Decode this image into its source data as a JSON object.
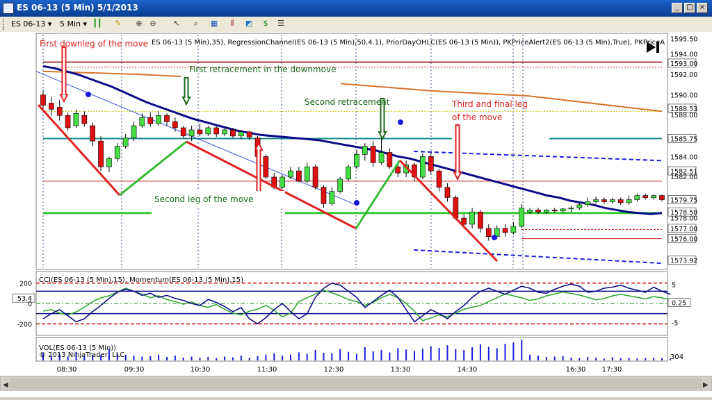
{
  "window": {
    "title": "ES 06-13 (5 Min)  5/1/2013",
    "minimize": "_",
    "maximize": "□",
    "close": "×"
  },
  "toolbar": {
    "instrument": "ES 06-13",
    "period": "5 Min"
  },
  "colors": {
    "up_candle": "#44dd44",
    "down_candle": "#e01010",
    "regression": "#0b0b8a",
    "annotation_red": "#e02020",
    "annotation_green": "#1a6a1a",
    "cci": "#0b0b8a",
    "momentum": "#33aa33"
  },
  "price_panel": {
    "legend": "ES 06-13 (5 Min),35), RegressionChannel(ES 06-13 (5 Min),50,4.1), PriorDayOHLC(ES 06-13 (5 Min)), PKPriceAlert2(ES 06-13 (5 Min),True), PKPriceA",
    "axis_labels": [
      "1595.50",
      "1594.00",
      "1593.00",
      "1592.00",
      "1590.00",
      "1588.53",
      "1588.00",
      "1585.75",
      "1584.00",
      "1582.51",
      "1582.00",
      "1579.75",
      "1578.50",
      "1578.00",
      "1577.00",
      "1576.00",
      "1573.92"
    ],
    "annotations": {
      "first_downleg": "First downleg of the move",
      "first_retracement": "First retracement in the downmove",
      "second_retracement": "Second retracement",
      "third_leg_line1": "Third and final leg",
      "third_leg_line2": "of the move",
      "second_leg": "Second leg of the move"
    }
  },
  "indicator_panel": {
    "legend": "CCI(ES 06-13 (5 Min),15), Momentum(ES 06-13 (5 Min),15)",
    "left_labels": [
      "200",
      "53.4",
      "0",
      "-200"
    ],
    "right_labels": [
      "5",
      "0.25",
      "-5"
    ]
  },
  "volume_panel": {
    "legend": "VOL(ES 06-13 (5 Min))",
    "copyright": "© 2013 NinjaTrader, LLC",
    "right_label": "304"
  },
  "time_axis": {
    "labels": [
      "08:30",
      "09:30",
      "10:30",
      "11:30",
      "12:30",
      "13:30",
      "14:30",
      "16:30",
      "17:30"
    ]
  },
  "chart_data": {
    "type": "candlestick",
    "x_labels": [
      "08:30",
      "09:30",
      "10:30",
      "11:30",
      "12:30",
      "13:30",
      "14:30",
      "16:30",
      "17:30"
    ],
    "price_range": [
      1573.0,
      1596.0
    ],
    "candles": [
      {
        "o": 1590.0,
        "c": 1589.0,
        "h": 1590.5,
        "l": 1588.5
      },
      {
        "o": 1589.2,
        "c": 1588.6,
        "h": 1589.8,
        "l": 1588.0
      },
      {
        "o": 1588.8,
        "c": 1588.0,
        "h": 1589.5,
        "l": 1587.5
      },
      {
        "o": 1588.0,
        "c": 1586.8,
        "h": 1588.3,
        "l": 1586.5
      },
      {
        "o": 1587.0,
        "c": 1588.2,
        "h": 1588.6,
        "l": 1586.8
      },
      {
        "o": 1588.0,
        "c": 1587.2,
        "h": 1588.4,
        "l": 1586.9
      },
      {
        "o": 1587.0,
        "c": 1585.5,
        "h": 1587.3,
        "l": 1585.0
      },
      {
        "o": 1585.5,
        "c": 1583.0,
        "h": 1586.0,
        "l": 1582.6
      },
      {
        "o": 1583.0,
        "c": 1583.8,
        "h": 1584.0,
        "l": 1582.5
      },
      {
        "o": 1583.8,
        "c": 1585.0,
        "h": 1585.3,
        "l": 1583.5
      },
      {
        "o": 1585.0,
        "c": 1585.8,
        "h": 1586.2,
        "l": 1584.8
      },
      {
        "o": 1585.8,
        "c": 1587.0,
        "h": 1587.4,
        "l": 1585.5
      },
      {
        "o": 1587.0,
        "c": 1587.8,
        "h": 1588.2,
        "l": 1586.8
      },
      {
        "o": 1587.8,
        "c": 1587.2,
        "h": 1588.3,
        "l": 1586.9
      },
      {
        "o": 1587.2,
        "c": 1588.0,
        "h": 1588.4,
        "l": 1587.0
      },
      {
        "o": 1588.0,
        "c": 1587.4,
        "h": 1588.2,
        "l": 1587.0
      },
      {
        "o": 1587.4,
        "c": 1586.8,
        "h": 1587.8,
        "l": 1586.4
      },
      {
        "o": 1586.8,
        "c": 1586.0,
        "h": 1587.0,
        "l": 1585.8
      },
      {
        "o": 1586.0,
        "c": 1586.6,
        "h": 1587.0,
        "l": 1585.5
      },
      {
        "o": 1586.6,
        "c": 1586.2,
        "h": 1587.2,
        "l": 1586.0
      },
      {
        "o": 1586.2,
        "c": 1586.8,
        "h": 1587.0,
        "l": 1586.0
      },
      {
        "o": 1586.8,
        "c": 1586.2,
        "h": 1587.0,
        "l": 1585.9
      },
      {
        "o": 1586.2,
        "c": 1586.6,
        "h": 1586.9,
        "l": 1586.0
      },
      {
        "o": 1586.6,
        "c": 1586.0,
        "h": 1586.8,
        "l": 1585.8
      },
      {
        "o": 1586.0,
        "c": 1586.4,
        "h": 1586.6,
        "l": 1585.7
      },
      {
        "o": 1586.4,
        "c": 1585.9,
        "h": 1586.5,
        "l": 1585.6
      },
      {
        "o": 1585.8,
        "c": 1584.0,
        "h": 1586.0,
        "l": 1583.8
      },
      {
        "o": 1584.0,
        "c": 1582.0,
        "h": 1584.2,
        "l": 1581.8
      },
      {
        "o": 1582.0,
        "c": 1581.0,
        "h": 1582.4,
        "l": 1580.8
      },
      {
        "o": 1581.0,
        "c": 1582.0,
        "h": 1582.2,
        "l": 1580.9
      },
      {
        "o": 1582.0,
        "c": 1582.6,
        "h": 1583.0,
        "l": 1581.8
      },
      {
        "o": 1582.6,
        "c": 1581.6,
        "h": 1583.0,
        "l": 1581.5
      },
      {
        "o": 1581.6,
        "c": 1583.0,
        "h": 1583.4,
        "l": 1581.4
      },
      {
        "o": 1583.0,
        "c": 1581.0,
        "h": 1583.2,
        "l": 1580.8
      },
      {
        "o": 1581.0,
        "c": 1579.4,
        "h": 1581.2,
        "l": 1579.0
      },
      {
        "o": 1579.4,
        "c": 1580.6,
        "h": 1581.0,
        "l": 1579.2
      },
      {
        "o": 1580.6,
        "c": 1581.8,
        "h": 1582.0,
        "l": 1580.4
      },
      {
        "o": 1581.8,
        "c": 1583.0,
        "h": 1583.2,
        "l": 1581.6
      },
      {
        "o": 1583.0,
        "c": 1584.2,
        "h": 1584.6,
        "l": 1582.8
      },
      {
        "o": 1584.2,
        "c": 1585.0,
        "h": 1585.3,
        "l": 1583.6
      },
      {
        "o": 1585.0,
        "c": 1583.4,
        "h": 1585.5,
        "l": 1583.0
      },
      {
        "o": 1583.4,
        "c": 1584.4,
        "h": 1586.2,
        "l": 1583.2
      },
      {
        "o": 1584.4,
        "c": 1583.0,
        "h": 1584.8,
        "l": 1582.8
      },
      {
        "o": 1583.0,
        "c": 1582.4,
        "h": 1583.5,
        "l": 1582.0
      },
      {
        "o": 1582.4,
        "c": 1583.2,
        "h": 1583.6,
        "l": 1582.0
      },
      {
        "o": 1583.2,
        "c": 1582.0,
        "h": 1583.4,
        "l": 1581.6
      },
      {
        "o": 1582.0,
        "c": 1584.0,
        "h": 1584.3,
        "l": 1581.8
      },
      {
        "o": 1584.0,
        "c": 1582.6,
        "h": 1584.4,
        "l": 1582.2
      },
      {
        "o": 1582.6,
        "c": 1581.0,
        "h": 1582.8,
        "l": 1580.6
      },
      {
        "o": 1581.0,
        "c": 1580.0,
        "h": 1581.4,
        "l": 1579.6
      },
      {
        "o": 1580.0,
        "c": 1578.0,
        "h": 1580.2,
        "l": 1577.8
      },
      {
        "o": 1578.0,
        "c": 1577.4,
        "h": 1578.4,
        "l": 1577.0
      },
      {
        "o": 1577.4,
        "c": 1578.6,
        "h": 1579.0,
        "l": 1577.0
      },
      {
        "o": 1578.6,
        "c": 1577.0,
        "h": 1578.8,
        "l": 1576.6
      },
      {
        "o": 1577.0,
        "c": 1576.2,
        "h": 1577.4,
        "l": 1575.8
      },
      {
        "o": 1576.2,
        "c": 1577.0,
        "h": 1577.3,
        "l": 1576.0
      },
      {
        "o": 1577.0,
        "c": 1576.6,
        "h": 1577.4,
        "l": 1576.2
      },
      {
        "o": 1576.6,
        "c": 1577.2,
        "h": 1577.6,
        "l": 1576.4
      },
      {
        "o": 1577.2,
        "c": 1579.0,
        "h": 1579.4,
        "l": 1577.0
      },
      {
        "o": 1578.6,
        "c": 1578.8,
        "h": 1579.0,
        "l": 1578.4
      },
      {
        "o": 1578.8,
        "c": 1578.6,
        "h": 1579.0,
        "l": 1578.4
      },
      {
        "o": 1578.6,
        "c": 1578.8,
        "h": 1578.9,
        "l": 1578.4
      },
      {
        "o": 1578.8,
        "c": 1578.7,
        "h": 1579.0,
        "l": 1578.5
      },
      {
        "o": 1578.7,
        "c": 1578.9,
        "h": 1579.0,
        "l": 1578.5
      },
      {
        "o": 1578.9,
        "c": 1579.0,
        "h": 1579.2,
        "l": 1578.6
      },
      {
        "o": 1579.0,
        "c": 1579.3,
        "h": 1579.5,
        "l": 1578.8
      },
      {
        "o": 1579.3,
        "c": 1579.6,
        "h": 1580.0,
        "l": 1579.1
      },
      {
        "o": 1579.6,
        "c": 1579.8,
        "h": 1580.1,
        "l": 1579.4
      },
      {
        "o": 1579.8,
        "c": 1579.6,
        "h": 1580.0,
        "l": 1579.4
      },
      {
        "o": 1579.6,
        "c": 1579.8,
        "h": 1580.0,
        "l": 1579.4
      },
      {
        "o": 1579.8,
        "c": 1579.5,
        "h": 1580.0,
        "l": 1579.3
      },
      {
        "o": 1579.5,
        "c": 1579.8,
        "h": 1580.2,
        "l": 1579.3
      },
      {
        "o": 1579.8,
        "c": 1580.2,
        "h": 1580.4,
        "l": 1579.6
      },
      {
        "o": 1580.2,
        "c": 1580.0,
        "h": 1580.4,
        "l": 1579.8
      },
      {
        "o": 1580.0,
        "c": 1580.2,
        "h": 1580.3,
        "l": 1579.8
      },
      {
        "o": 1580.2,
        "c": 1579.8,
        "h": 1580.3,
        "l": 1579.6
      }
    ],
    "regression_line": [
      1592.8,
      1592.6,
      1592.3,
      1592.0,
      1591.6,
      1591.2,
      1590.8,
      1590.3,
      1589.8,
      1589.3,
      1588.9,
      1588.5,
      1588.1,
      1587.7,
      1587.4,
      1587.1,
      1586.8,
      1586.5,
      1586.3,
      1586.1,
      1586.0,
      1585.9,
      1585.8,
      1585.7,
      1585.6,
      1585.4,
      1585.2,
      1585.0,
      1584.8,
      1584.6,
      1584.3,
      1584.0,
      1583.8,
      1583.5,
      1583.2,
      1582.9,
      1582.6,
      1582.3,
      1582.0,
      1581.7,
      1581.4,
      1581.1,
      1580.8,
      1580.5,
      1580.2,
      1580.0,
      1579.7,
      1579.5,
      1579.3,
      1579.0,
      1578.8,
      1578.6,
      1578.5,
      1578.4,
      1578.5
    ],
    "cci": [
      -150,
      -100,
      -60,
      -120,
      -180,
      -150,
      -80,
      -20,
      50,
      110,
      140,
      120,
      80,
      100,
      60,
      80,
      50,
      30,
      0,
      -20,
      40,
      10,
      -30,
      -80,
      -40,
      -150,
      -200,
      -140,
      -60,
      0,
      -80,
      -150,
      -100,
      60,
      150,
      200,
      180,
      120,
      60,
      -40,
      20,
      80,
      130,
      60,
      -60,
      -180,
      -120,
      -60,
      -100,
      -150,
      -80,
      -20,
      60,
      120,
      150,
      120,
      90,
      130,
      170,
      150,
      110,
      100,
      140,
      170,
      190,
      170,
      110,
      120,
      150,
      160,
      180,
      150,
      130,
      110,
      160,
      120,
      90
    ],
    "momentum": [
      -2.0,
      -1.6,
      -2.5,
      -3.0,
      -2.2,
      -1.0,
      0.5,
      1.5,
      2.0,
      3.0,
      4.0,
      3.2,
      2.4,
      1.5,
      2.0,
      1.0,
      0.5,
      -0.2,
      0.4,
      -0.5,
      -1.0,
      -0.3,
      -1.5,
      -2.5,
      -3.0,
      -2.0,
      -1.5,
      -0.5,
      -1.8,
      -3.5,
      -2.5,
      0.5,
      1.5,
      2.5,
      3.5,
      2.8,
      2.0,
      1.0,
      0.5,
      -0.5,
      0.3,
      1.5,
      2.4,
      1.5,
      0.0,
      -2.0,
      -4.5,
      -3.8,
      -3.0,
      -3.5,
      -2.5,
      -1.5,
      -1.0,
      -0.5,
      0.5,
      1.5,
      2.5,
      2.0,
      1.5,
      0.8,
      1.2,
      2.0,
      2.5,
      3.0,
      2.6,
      2.2,
      1.6,
      1.0,
      1.3,
      2.0,
      2.4,
      2.0,
      1.6,
      1.2,
      1.8,
      1.5,
      1.0
    ],
    "volume": [
      40,
      25,
      35,
      20,
      45,
      22,
      30,
      28,
      60,
      35,
      30,
      25,
      20,
      22,
      30,
      18,
      25,
      15,
      20,
      15,
      18,
      12,
      20,
      16,
      25,
      14,
      22,
      30,
      38,
      25,
      30,
      42,
      35,
      55,
      40,
      38,
      60,
      45,
      35,
      70,
      48,
      55,
      42,
      65,
      58,
      50,
      62,
      75,
      66,
      80,
      60,
      55,
      70,
      85,
      72,
      64,
      88,
      95,
      110,
      30,
      25,
      18,
      20,
      22,
      15,
      12,
      18,
      14,
      10,
      16,
      12,
      14,
      10,
      12,
      15,
      12,
      10
    ],
    "cci_range": [
      -300,
      300
    ],
    "momentum_range": [
      -8,
      8
    ]
  }
}
